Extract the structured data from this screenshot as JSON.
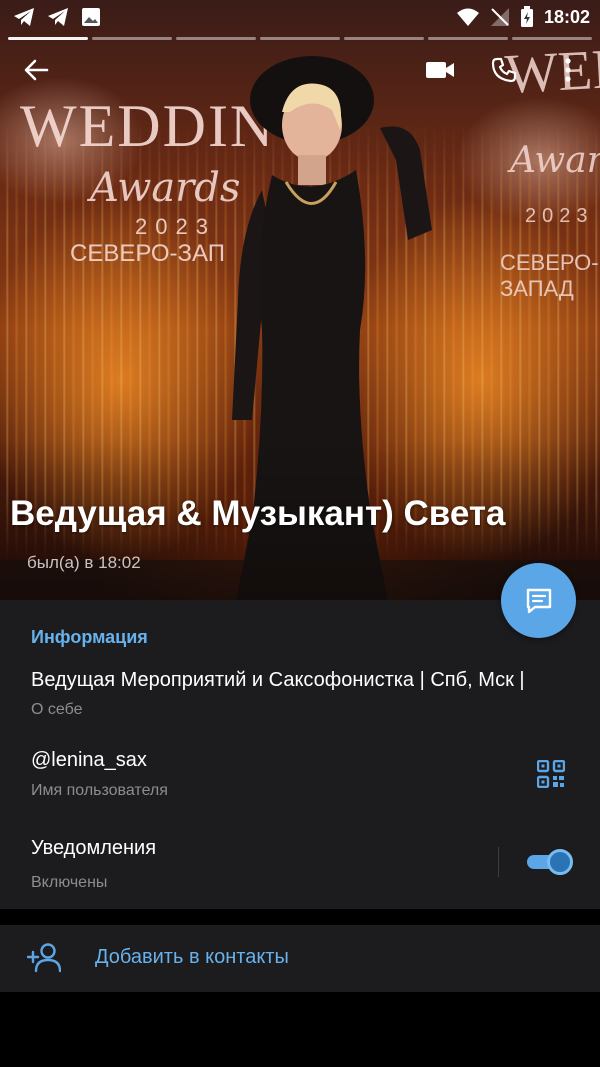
{
  "status_bar": {
    "time": "18:02",
    "left_icons": [
      "telegram-icon",
      "telegram-icon",
      "image-icon"
    ],
    "right_icons": [
      "wifi-icon",
      "no-signal-icon",
      "battery-charging-icon"
    ]
  },
  "photo_text": {
    "wedding": "WEDDIN",
    "awards": "Awards",
    "year": "2023",
    "region": "СЕВЕРО-ЗАП",
    "wedding_right": "WEDDI",
    "awards_right": "Awards",
    "year_right": "2023",
    "region_right": "СЕВЕРО-ЗАПАД"
  },
  "profile": {
    "name_marquee": "Ведущая & Музыкант)    Света",
    "last_seen": "был(а) в 18:02"
  },
  "info": {
    "section_title": "Информация",
    "bio": "Ведущая Мероприятий и Саксофонистка | Спб, Мск |",
    "bio_label": "О себе",
    "username": "@lenina_sax",
    "username_label": "Имя пользователя",
    "notifications": "Уведомления",
    "notifications_state": "Включены",
    "notifications_on": true
  },
  "actions": {
    "add_contact": "Добавить в контакты"
  },
  "colors": {
    "accent": "#5aa6e6",
    "link": "#67b2ec",
    "panel": "#1c1c1e"
  }
}
